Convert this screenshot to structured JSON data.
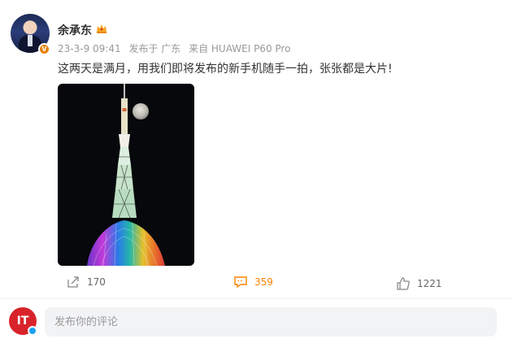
{
  "author": {
    "name": "余承东",
    "verified_badge": "V"
  },
  "meta": {
    "time": "23-3-9 09:41",
    "location": "发布于 广东",
    "device": "来自 HUAWEI P60 Pro"
  },
  "post": {
    "text": "这两天是满月，用我们即将发布的新手机随手一拍，张张都是大片!"
  },
  "actions": {
    "share_count": "170",
    "comment_count": "359",
    "like_count": "1221"
  },
  "comment_box": {
    "user_avatar_text": "IT",
    "placeholder": "发布你的评论"
  },
  "colors": {
    "accent": "#ff8200",
    "meta_text": "#999999",
    "input_bg": "#f2f3f5"
  }
}
